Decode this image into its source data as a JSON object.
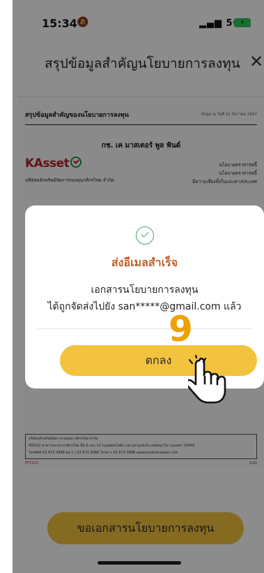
{
  "status_bar": {
    "time": "15:34",
    "signal": "5G",
    "battery_color": "#34c759"
  },
  "header": {
    "title": "สรุปข้อมูลสำคัญนโยบายการลงทุน",
    "close_icon": "close-icon"
  },
  "document": {
    "title": "สรุปข้อมูลสำคัญของนโยบายการลงทุน",
    "as_of": "ข้อมูล ณ วันที่ 31 ธันวาคม 2567",
    "fund_name": "กช. เค มาสเตอร์ พูล ฟันด์",
    "logo_text": "KAsset",
    "company": "บริษัทหลักทรัพย์จัดการกองทุนกสิกรไทย จำกัด",
    "policies": [
      "นโยบายตราสารหนี้",
      "นโยบายตราสารหนี้",
      "มีความเสี่ยงทั้งในและต่างประเทศ"
    ],
    "footer_lines": [
      "บริษัทหลักทรัพย์จัดการกองทุน กสิกรไทย จำกัด",
      "400/22 อาคารธนาคารกสิกรไทย ชั้น 6 และ 12 ถนนพหลโยธิน แขวงสามเสนใน เขตพญาไท กรุงเทพฯ 10400",
      "โทรศัพท์ 02 673 3888 ต่อ 1 / 02 673 3999 โทรสาร 02 673 3988 www.kasikornasset.com"
    ],
    "doc_code": "PF2102",
    "page": "1/11"
  },
  "dialog": {
    "success_icon": "check-circle-icon",
    "title": "ส่งอีเมลสำเร็จ",
    "message_line1": "เอกสารนโยบายการลงทุน",
    "message_line2": "ได้ถูกจัดส่งไปยัง san*****@gmail.com แล้ว",
    "ok_label": "ตกลง"
  },
  "bottom_button": {
    "label": "ขอเอกสารนโยบายการลงทุน"
  },
  "annotation": {
    "step": "9",
    "pointer_icon": "hand-pointer-icon"
  },
  "colors": {
    "primary_button": "#f3c23e",
    "dialog_title": "#c0602c",
    "success": "#4aa36b",
    "step_number": "#f0a000"
  }
}
